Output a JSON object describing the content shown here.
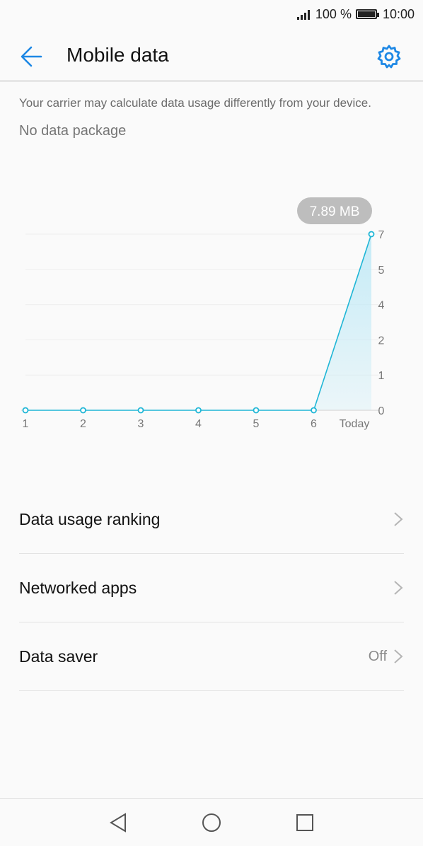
{
  "status_bar": {
    "battery_percent": "100 %",
    "time": "10:00"
  },
  "header": {
    "title": "Mobile data"
  },
  "notice": "Your carrier may calculate data usage differently from your device.",
  "package_text": "No data package",
  "chart_data": {
    "type": "area",
    "categories": [
      "1",
      "2",
      "3",
      "4",
      "5",
      "6",
      "Today"
    ],
    "values": [
      0,
      0,
      0,
      0,
      0,
      0,
      7
    ],
    "yticks": [
      "7",
      "5",
      "4",
      "2",
      "1",
      "0"
    ],
    "ylim": [
      0,
      7
    ],
    "tooltip": "7.89 MB",
    "grid": true,
    "colors": {
      "line": "#1fb6d6",
      "fill": "#bfe9f6"
    }
  },
  "menu": {
    "items": [
      {
        "label": "Data usage ranking",
        "value": ""
      },
      {
        "label": "Networked apps",
        "value": ""
      },
      {
        "label": "Data saver",
        "value": "Off"
      }
    ]
  },
  "colors": {
    "accent": "#1e88e5"
  }
}
